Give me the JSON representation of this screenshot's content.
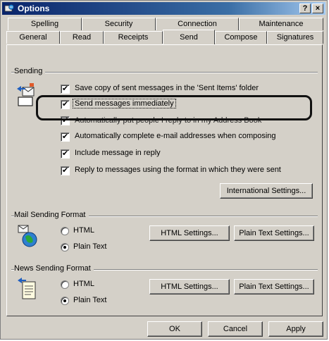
{
  "window": {
    "title": "Options",
    "help_btn": "?",
    "close_btn": "×"
  },
  "tabs_back": [
    "Spelling",
    "Security",
    "Connection",
    "Maintenance"
  ],
  "tabs_front": [
    "General",
    "Read",
    "Receipts",
    "Send",
    "Compose",
    "Signatures"
  ],
  "sending": {
    "label": "Sending",
    "items": [
      "Save copy of sent messages in the 'Sent Items' folder",
      "Send messages immediately",
      "Automatically put people I reply to in my Address Book",
      "Automatically complete e-mail addresses when composing",
      "Include message in reply",
      "Reply to messages using the format in which they were sent"
    ],
    "intl_button": "International Settings..."
  },
  "mail_format": {
    "label": "Mail Sending Format",
    "options": [
      "HTML",
      "Plain Text"
    ],
    "selected": "Plain Text",
    "html_button": "HTML Settings...",
    "plain_button": "Plain Text Settings..."
  },
  "news_format": {
    "label": "News Sending Format",
    "options": [
      "HTML",
      "Plain Text"
    ],
    "selected": "Plain Text",
    "html_button": "HTML Settings...",
    "plain_button": "Plain Text Settings..."
  },
  "footer": {
    "ok": "OK",
    "cancel": "Cancel",
    "apply": "Apply"
  }
}
